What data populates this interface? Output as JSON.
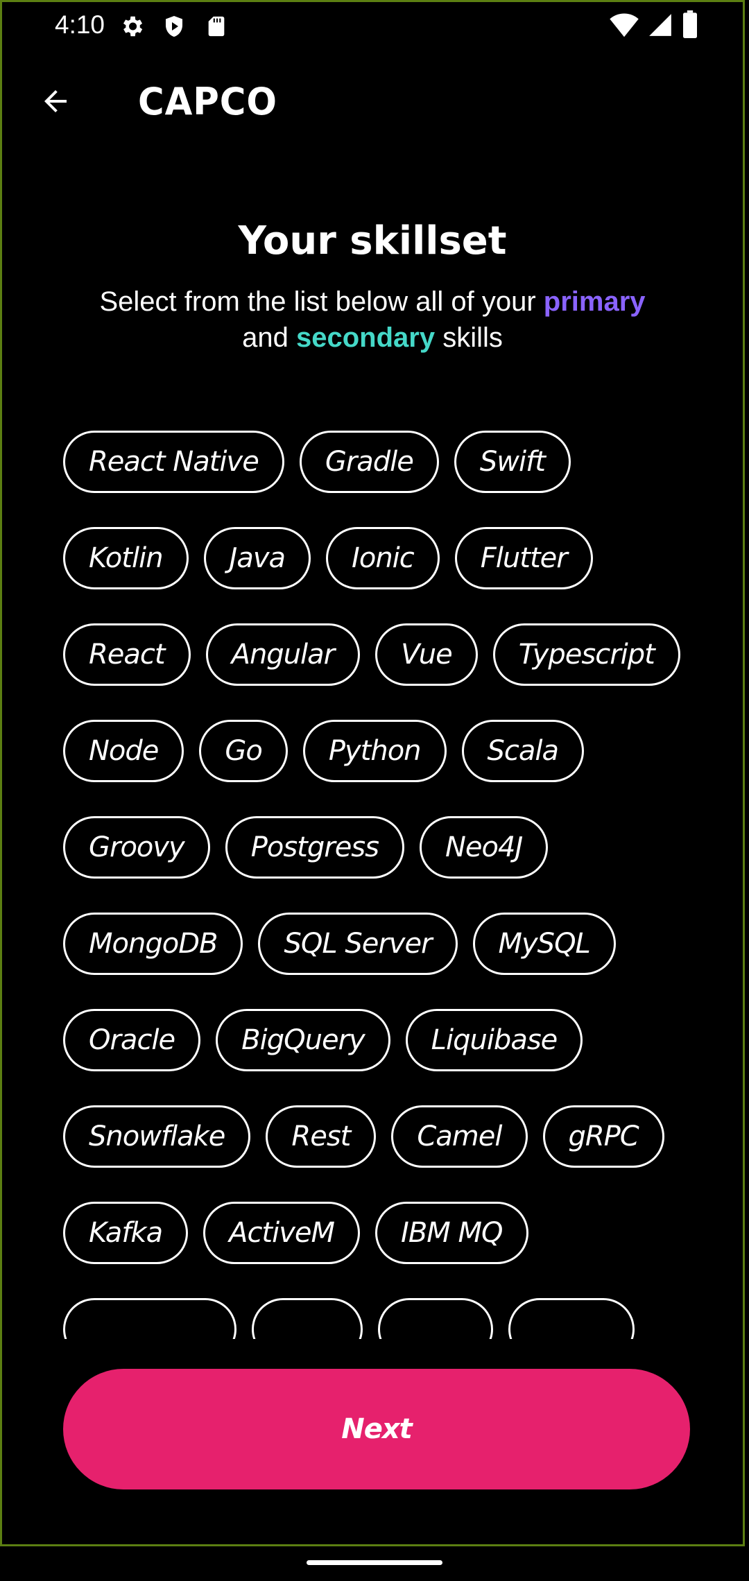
{
  "status_bar": {
    "time": "4:10",
    "icons": [
      "settings-icon",
      "shield-play-icon",
      "sd-card-icon",
      "wifi-icon",
      "signal-icon",
      "battery-icon"
    ]
  },
  "app_bar": {
    "logo_text": "CAPCO",
    "back_icon": "arrow-back-icon"
  },
  "header": {
    "title": "Your skillset",
    "subtitle_part1": "Select from the list below all of your ",
    "primary_word": "primary",
    "subtitle_part2": "and ",
    "secondary_word": "secondary",
    "subtitle_part3": " skills"
  },
  "skills": [
    "React Native",
    "Gradle",
    "Swift",
    "Kotlin",
    "Java",
    "Ionic",
    "Flutter",
    "React",
    "Angular",
    "Vue",
    "Typescript",
    "Node",
    "Go",
    "Python",
    "Scala",
    "Groovy",
    "Postgress",
    "Neo4J",
    "MongoDB",
    "SQL Server",
    "MySQL",
    "Oracle",
    "BigQuery",
    "Liquibase",
    "Snowflake",
    "Rest",
    "Camel",
    "gRPC",
    "Kafka",
    "ActiveM",
    "IBM MQ"
  ],
  "next_button": {
    "label": "Next"
  },
  "colors": {
    "background": "#000000",
    "primary_highlight": "#8a63ff",
    "secondary_highlight": "#45d8c8",
    "next_button": "#e6216d",
    "frame_border": "#5c7f12"
  }
}
